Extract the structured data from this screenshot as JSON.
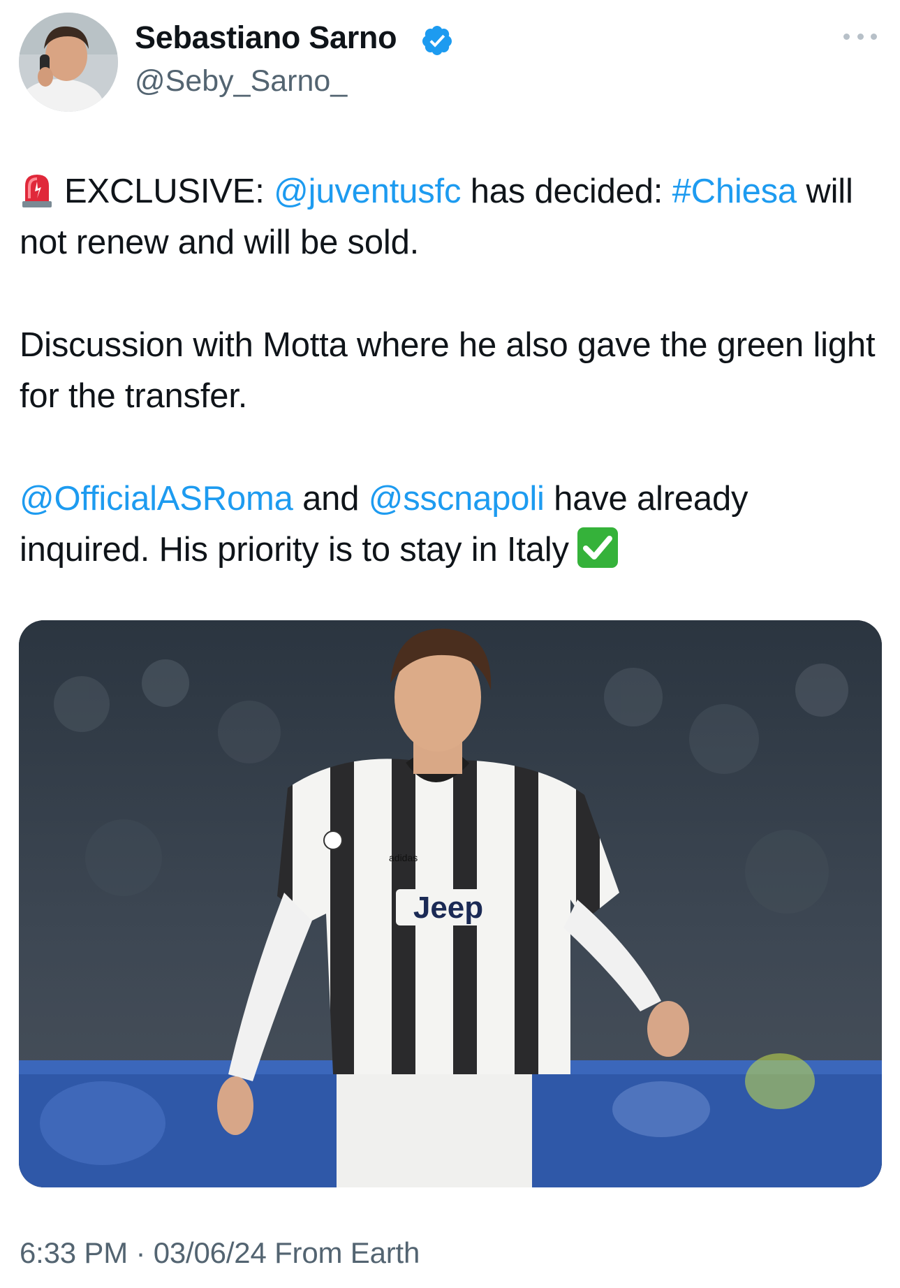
{
  "author": {
    "name": "Sebastiano Sarno",
    "handle": "@Seby_Sarno_",
    "verified_color": "#1d9bf0"
  },
  "tweet": {
    "lines": {
      "p1": {
        "emoji": "rotating-light-icon",
        "lead": "EXCLUSIVE:",
        "mention": "@juventusfc",
        "mid": "has decided:",
        "hashtag": "#Chiesa",
        "rest": "will not renew and will be sold."
      },
      "p2": {
        "text": "Discussion with Motta where he also gave the green light for the transfer."
      },
      "p3": {
        "mention1": "@OfficialASRoma",
        "and": "and",
        "mention2": "@sscnapoli",
        "rest": "have already inquired. His priority is to stay in Italy",
        "emoji": "check-mark-button-icon"
      }
    },
    "media": {
      "shirt_text": "Jeep",
      "brand_text": "adidas"
    },
    "meta": "6:33 PM · 03/06/24 From Earth"
  },
  "colors": {
    "link": "#1d9bf0",
    "text": "#0f1419",
    "secondary": "#536471"
  }
}
